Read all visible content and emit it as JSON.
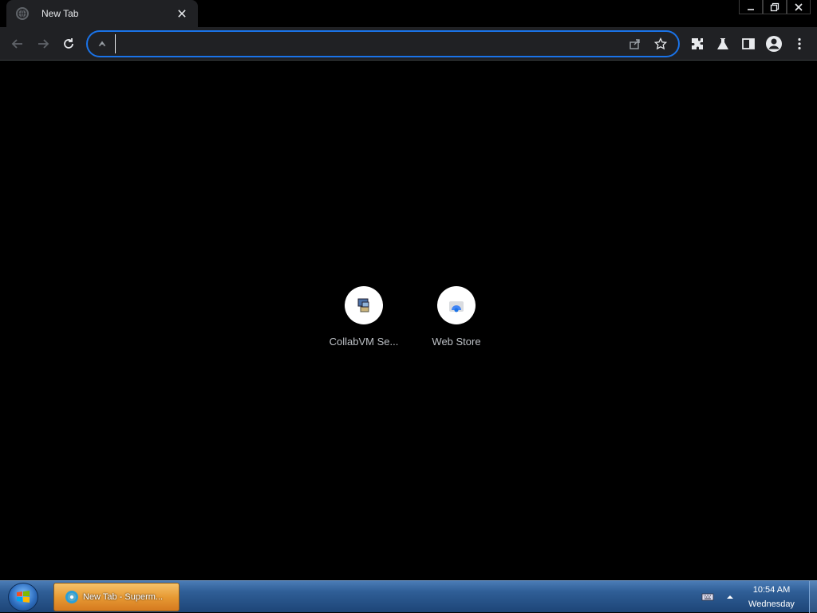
{
  "browser": {
    "tab": {
      "title": "New Tab",
      "close_icon": "close-icon"
    },
    "window_controls": [
      "minimize-icon",
      "restore-icon",
      "close-icon"
    ],
    "omnibox": {
      "value": "",
      "placeholder": ""
    },
    "toolbar_icons": [
      "back-icon",
      "forward-icon",
      "reload-icon",
      "share-icon",
      "bookmark-star-icon",
      "extensions-icon",
      "labs-flask-icon",
      "side-panel-icon",
      "profile-icon",
      "menu-kebab-icon"
    ]
  },
  "newtab": {
    "shortcuts": [
      {
        "label": "CollabVM Se...",
        "icon": "collabvm-icon"
      },
      {
        "label": "Web Store",
        "icon": "web-store-icon"
      }
    ]
  },
  "taskbar": {
    "task_button": {
      "label": "New Tab - Superm..."
    },
    "clock": {
      "time": "10:54 AM",
      "day": "Wednesday"
    },
    "accent": "#e79a34"
  },
  "colors": {
    "accent": "#1a73e8",
    "toolbar": "#202124",
    "page_bg": "#000000"
  }
}
